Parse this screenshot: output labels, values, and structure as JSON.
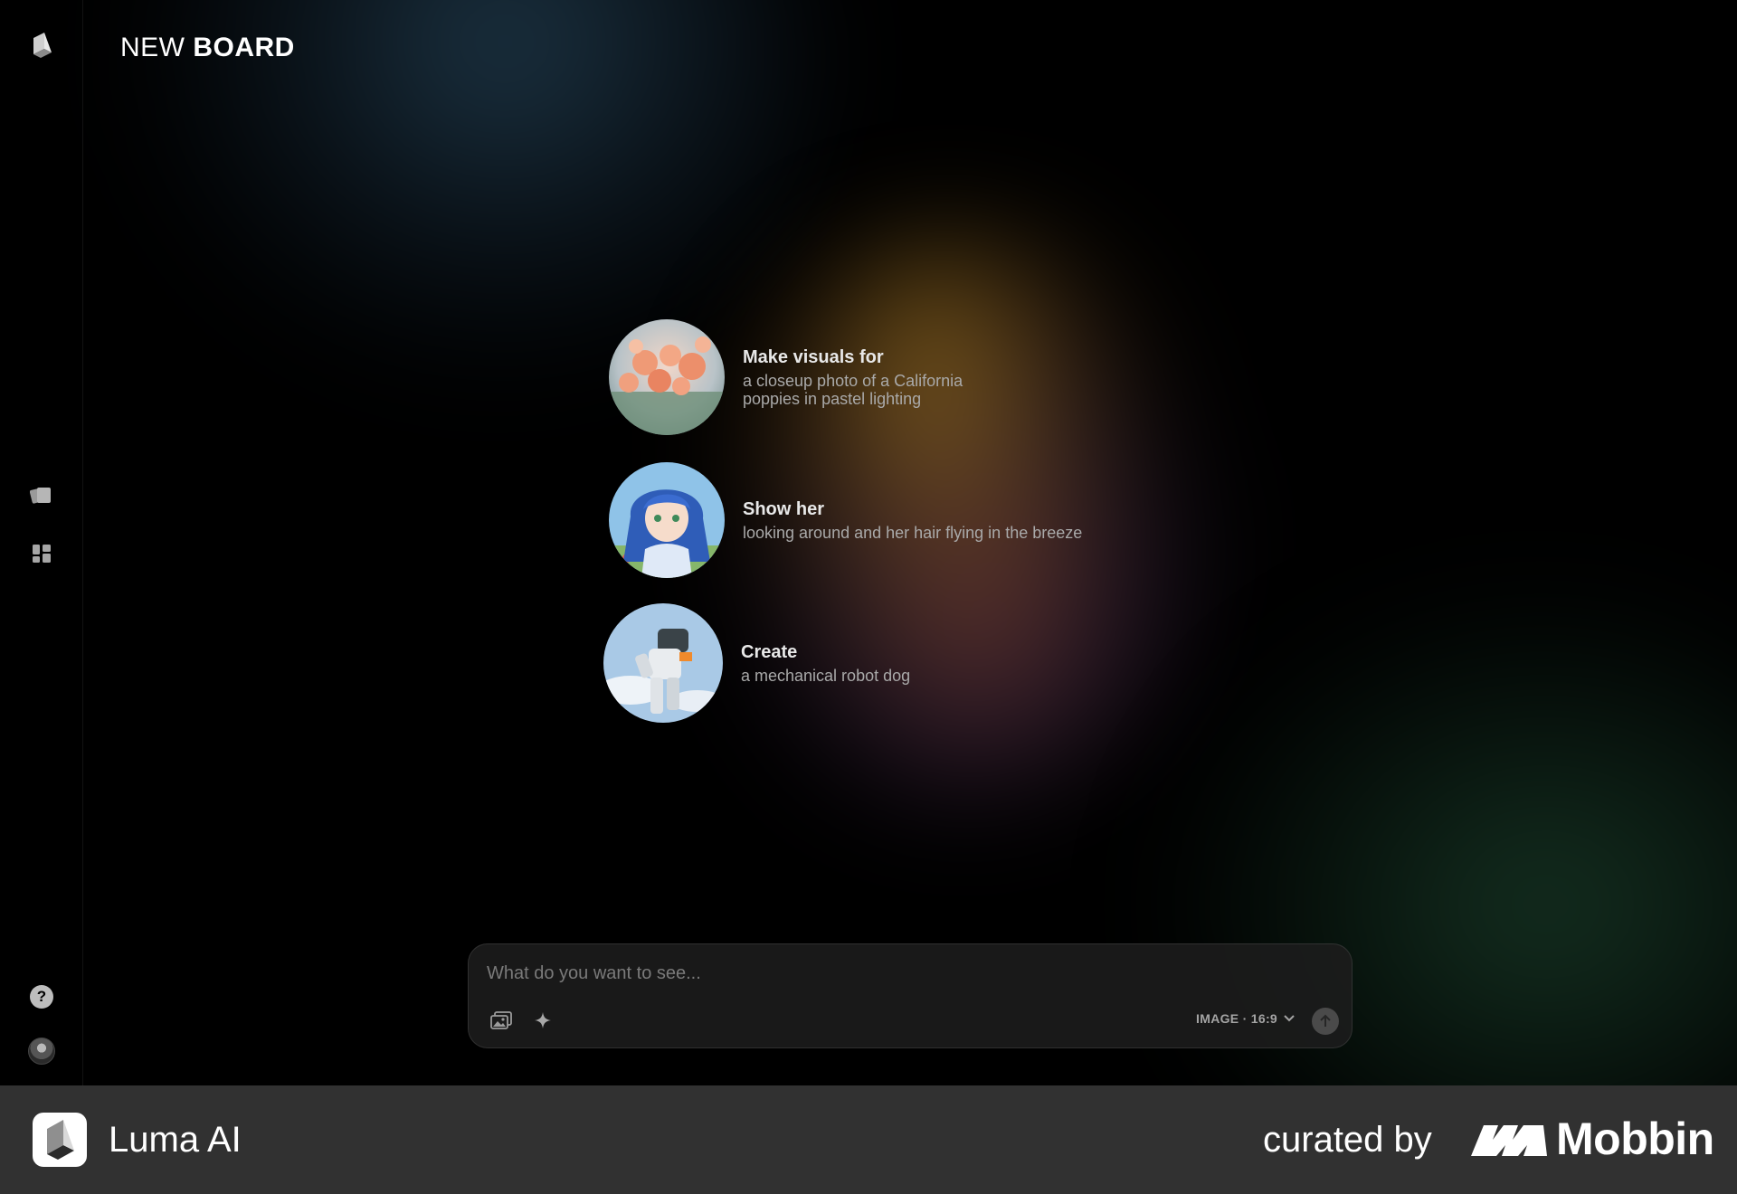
{
  "header": {
    "title_light": "NEW",
    "title_bold": "BOARD"
  },
  "sidebar": {
    "items": [
      {
        "name": "logo",
        "icon": "luma-logo-icon"
      },
      {
        "name": "boards",
        "icon": "boards-icon"
      },
      {
        "name": "grid",
        "icon": "grid-icon"
      },
      {
        "name": "help",
        "icon": "help-icon",
        "glyph": "?"
      },
      {
        "name": "avatar",
        "icon": "avatar"
      }
    ]
  },
  "suggestions": [
    {
      "title": "Make visuals for",
      "description": "a closeup photo of a California poppies in pastel lighting",
      "image": "poppies-image"
    },
    {
      "title": "Show her",
      "description": "looking around and her hair flying in the breeze",
      "image": "anime-girl-image"
    },
    {
      "title": "Create",
      "description": "a mechanical robot dog",
      "image": "robot-image"
    }
  ],
  "prompt": {
    "placeholder": "What do you want to see...",
    "value": "",
    "mode_label": "IMAGE · 16:9"
  },
  "footer": {
    "brand": "Luma AI",
    "curated_label": "curated by",
    "curator": "Mobbin"
  },
  "colors": {
    "background": "#000000",
    "footer_bg": "#313131",
    "muted_text": "#a9a9a9"
  }
}
